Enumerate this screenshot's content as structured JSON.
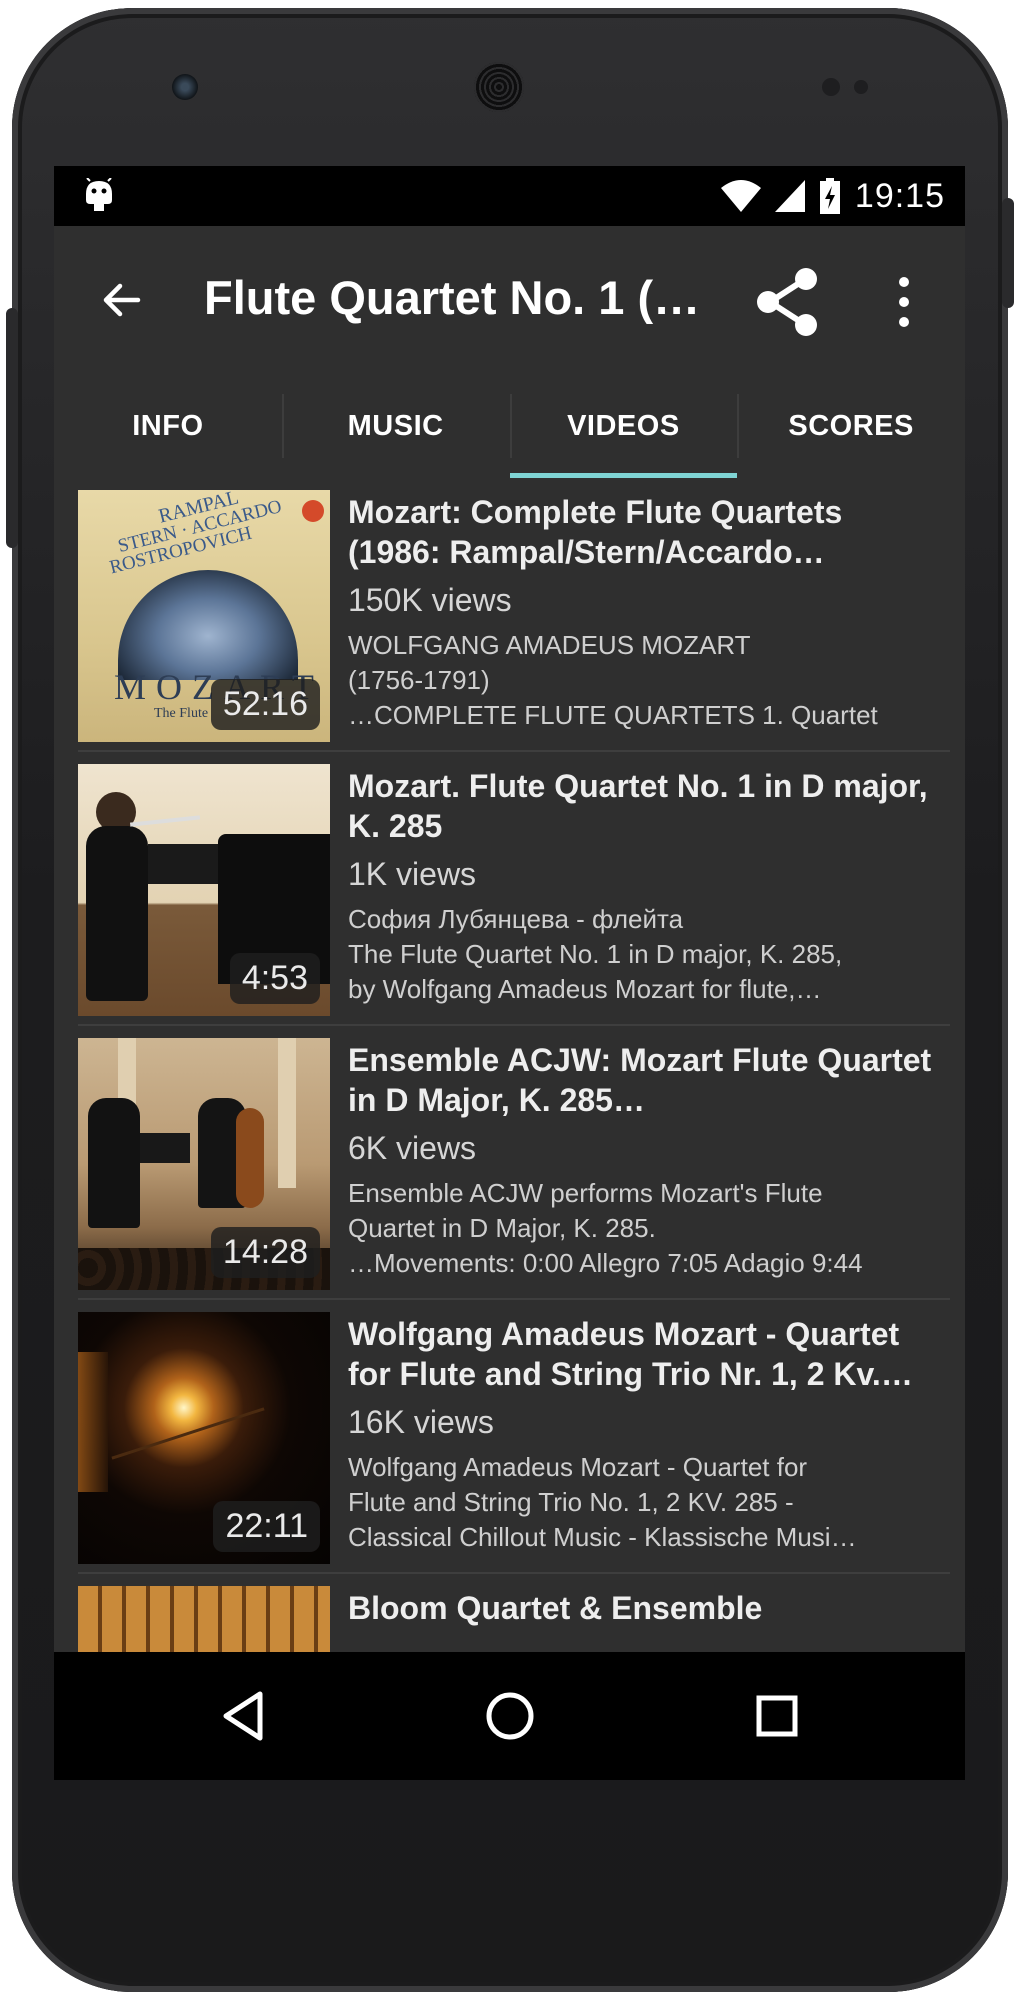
{
  "status_bar": {
    "time": "19:15",
    "icons": [
      "android-icon",
      "wifi-icon",
      "signal-icon",
      "battery-charging-icon"
    ]
  },
  "app_bar": {
    "title": "Flute Quartet No. 1 (…",
    "icons": [
      "back-arrow-icon",
      "share-icon",
      "more-vert-icon"
    ]
  },
  "tabs": [
    {
      "label": "INFO",
      "active": false
    },
    {
      "label": "MUSIC",
      "active": false
    },
    {
      "label": "VIDEOS",
      "active": true
    },
    {
      "label": "SCORES",
      "active": false
    }
  ],
  "accent_color": "#7fd4d4",
  "videos": [
    {
      "title": "Mozart: Complete Flute Quartets (1986: Rampal/Stern/Accardo…",
      "views": "150K views",
      "duration": "52:16",
      "description": [
        "WOLFGANG AMADEUS MOZART",
        "(1756-1791)",
        "…COMPLETE FLUTE QUARTETS    1. Quartet"
      ],
      "thumb_text": [
        "RAMPAL",
        "STERN · ACCARDO",
        "ROSTROPOVICH",
        "MOZART",
        "The Flute"
      ]
    },
    {
      "title": "Mozart. Flute Quartet No. 1 in D major, K. 285",
      "views": "1K views",
      "duration": "4:53",
      "description": [
        "София Лубянцева - флейта",
        "The Flute Quartet No. 1 in D major, K. 285,",
        "by Wolfgang Amadeus Mozart for flute,…"
      ]
    },
    {
      "title": "Ensemble ACJW: Mozart Flute Quartet in D Major, K. 285…",
      "views": "6K views",
      "duration": "14:28",
      "description": [
        "Ensemble ACJW performs Mozart's Flute",
        "Quartet in D Major, K. 285.",
        "…Movements: 0:00 Allegro 7:05 Adagio 9:44"
      ]
    },
    {
      "title": "Wolfgang Amadeus Mozart - Quartet for Flute and String Trio Nr. 1, 2 Kv.…",
      "views": "16K views",
      "duration": "22:11",
      "description": [
        "Wolfgang Amadeus Mozart - Quartet for",
        "Flute and String Trio No. 1, 2 KV. 285 -",
        "Classical Chillout Music - Klassische Musi…"
      ]
    },
    {
      "title": "Bloom Quartet & Ensemble"
    }
  ],
  "nav_bar": {
    "icons": [
      "back-triangle-icon",
      "home-circle-icon",
      "recents-square-icon"
    ]
  }
}
